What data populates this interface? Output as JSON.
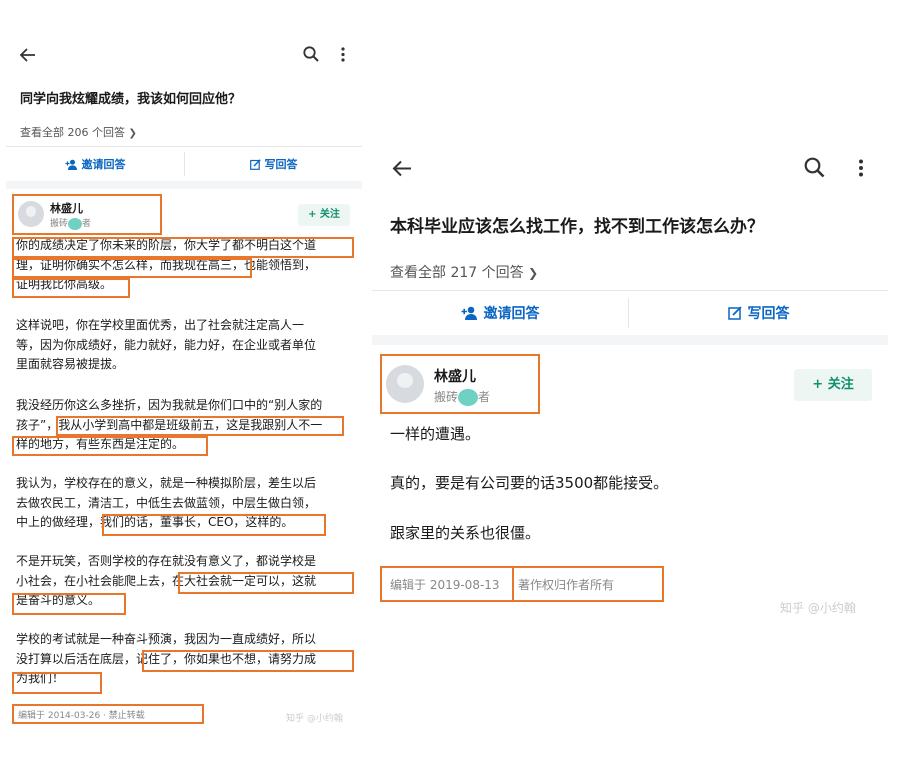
{
  "left": {
    "question_title": "同学向我炫耀成绩，我该如何回应他？",
    "view_all": "查看全部 206 个回答",
    "invite_label": "邀请回答",
    "write_label": "写回答",
    "author_name": "林盛儿",
    "author_desc_a": "搬砖",
    "author_desc_b": "者",
    "follow_label": "+ 关注",
    "paragraphs": [
      [
        "你的成绩决定了你未来的阶层，你大学了都不明白这个道",
        "理，证明你确实不怎么样，而我现在高三，也能领悟到，",
        "证明我比你高级。"
      ],
      [
        "这样说吧，你在学校里面优秀，出了社会就注定高人一",
        "等，因为你成绩好，能力就好，能力好，在企业或者单位",
        "里面就容易被提拔。"
      ],
      [
        "我没经历你这么多挫折，因为我就是你们口中的“别人家的",
        "孩子”，我从小学到高中都是班级前五，这是我跟别人不一",
        "样的地方，有些东西是注定的。"
      ],
      [
        "我认为，学校存在的意义，就是一种模拟阶层，差生以后",
        "去做农民工，清洁工，中低生去做蓝领，中层生做白领，",
        "中上的做经理，我们的话，董事长，CEO，这样的。"
      ],
      [
        "不是开玩笑，否则学校的存在就没有意义了，都说学校是",
        "小社会，在小社会能爬上去，在大社会就一定可以，这就",
        "是奋斗的意义。"
      ],
      [
        "学校的考试就是一种奋斗预演，我因为一直成绩好，所以",
        "没打算以后活在底层，记住了，你如果也不想，请努力成",
        "为我们！"
      ]
    ],
    "edit_info": "编辑于 2014-03-26 · 禁止转载",
    "watermark": "知乎 @小约翰"
  },
  "right": {
    "question_title": "本科毕业应该怎么找工作，找不到工作该怎么办？",
    "view_all": "查看全部 217 个回答",
    "invite_label": "邀请回答",
    "write_label": "写回答",
    "author_name": "林盛儿",
    "author_desc_a": "搬砖",
    "author_desc_b": "者",
    "follow_label": "+ 关注",
    "paragraphs": [
      "一样的遭遇。",
      "真的，要是有公司要的话3500都能接受。",
      "跟家里的关系也很僵。"
    ],
    "edit_date": "编辑于 2019-08-13",
    "copyright": "著作权归作者所有",
    "watermark": "知乎 @小约翰"
  },
  "colors": {
    "accent": "#0f8f6b",
    "highlight": "#e9772b",
    "link": "#0a66c2"
  }
}
